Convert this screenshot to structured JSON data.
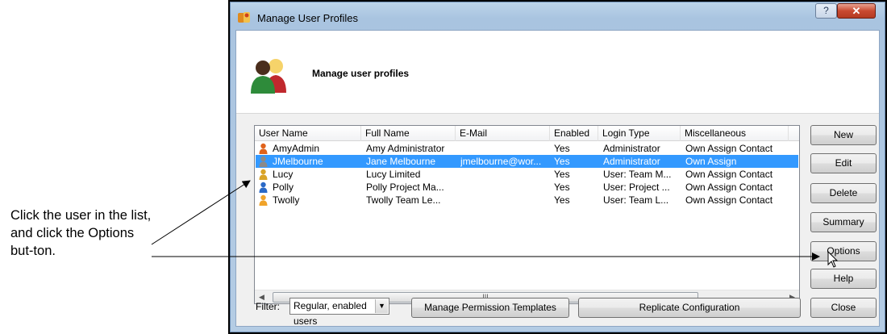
{
  "callout": {
    "text": "Click the user in the list, and click the Options but-ton."
  },
  "window": {
    "title": "Manage User Profiles",
    "help_label": "?",
    "close_label": "✕",
    "header_title": "Manage user profiles"
  },
  "list": {
    "columns": [
      "User Name",
      "Full Name",
      "E-Mail",
      "Enabled",
      "Login Type",
      "Miscellaneous"
    ],
    "rows": [
      {
        "user": "AmyAdmin",
        "full": "Amy Administrator",
        "email": "",
        "enabled": "Yes",
        "login": "Administrator",
        "misc": "Own Assign Contact",
        "icon_color": "#e0631c"
      },
      {
        "user": "JMelbourne",
        "full": "Jane Melbourne",
        "email": "jmelbourne@wor...",
        "enabled": "Yes",
        "login": "Administrator",
        "misc": "Own Assign",
        "icon_color": "#8a8a8a"
      },
      {
        "user": "Lucy",
        "full": "Lucy Limited",
        "email": "",
        "enabled": "Yes",
        "login": "User: Team M...",
        "misc": "Own Assign Contact",
        "icon_color": "#d9a428"
      },
      {
        "user": "Polly",
        "full": "Polly Project Ma...",
        "email": "",
        "enabled": "Yes",
        "login": "User: Project ...",
        "misc": "Own Assign Contact",
        "icon_color": "#2a69c7"
      },
      {
        "user": "Twolly",
        "full": "Twolly Team Le...",
        "email": "",
        "enabled": "Yes",
        "login": "User: Team L...",
        "misc": "Own Assign Contact",
        "icon_color": "#f0a32a"
      }
    ],
    "selected_user": "JMelbourne",
    "scroll_thumb_label": "III"
  },
  "buttons": {
    "new": "New",
    "edit": "Edit",
    "delete": "Delete",
    "summary": "Summary",
    "options": "Options",
    "help": "Help",
    "close": "Close",
    "manage_templates": "Manage Permission Templates",
    "replicate": "Replicate Configuration"
  },
  "filter": {
    "label": "Filter:",
    "value": "Regular, enabled users"
  }
}
